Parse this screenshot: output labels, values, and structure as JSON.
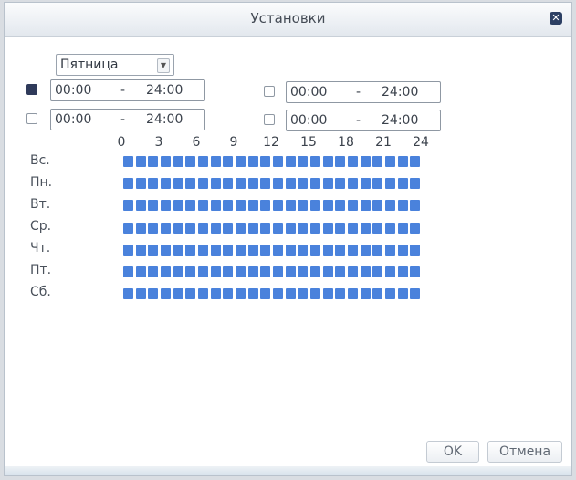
{
  "window": {
    "title": "Установки"
  },
  "day_select": {
    "value": "Пятница"
  },
  "periods": [
    {
      "checked": true,
      "start": "00:00",
      "separator": "-",
      "end": "24:00"
    },
    {
      "checked": false,
      "start": "00:00",
      "separator": "-",
      "end": "24:00"
    },
    {
      "checked": false,
      "start": "00:00",
      "separator": "-",
      "end": "24:00"
    },
    {
      "checked": false,
      "start": "00:00",
      "separator": "-",
      "end": "24:00"
    }
  ],
  "hours": [
    "0",
    "3",
    "6",
    "9",
    "12",
    "15",
    "18",
    "21",
    "24"
  ],
  "days": [
    "Вс.",
    "Пн.",
    "Вт.",
    "Ср.",
    "Чт.",
    "Пт.",
    "Сб."
  ],
  "schedule": {
    "cells_per_day": 24,
    "active_hours": [
      [
        0,
        24
      ],
      [
        0,
        24
      ],
      [
        0,
        24
      ],
      [
        0,
        24
      ],
      [
        0,
        24
      ],
      [
        0,
        24
      ],
      [
        0,
        24
      ]
    ]
  },
  "buttons": {
    "ok": "OK",
    "cancel": "Отмена"
  },
  "colors": {
    "active_cell": "#4a82dc",
    "checked_box": "#2f3a5a"
  }
}
